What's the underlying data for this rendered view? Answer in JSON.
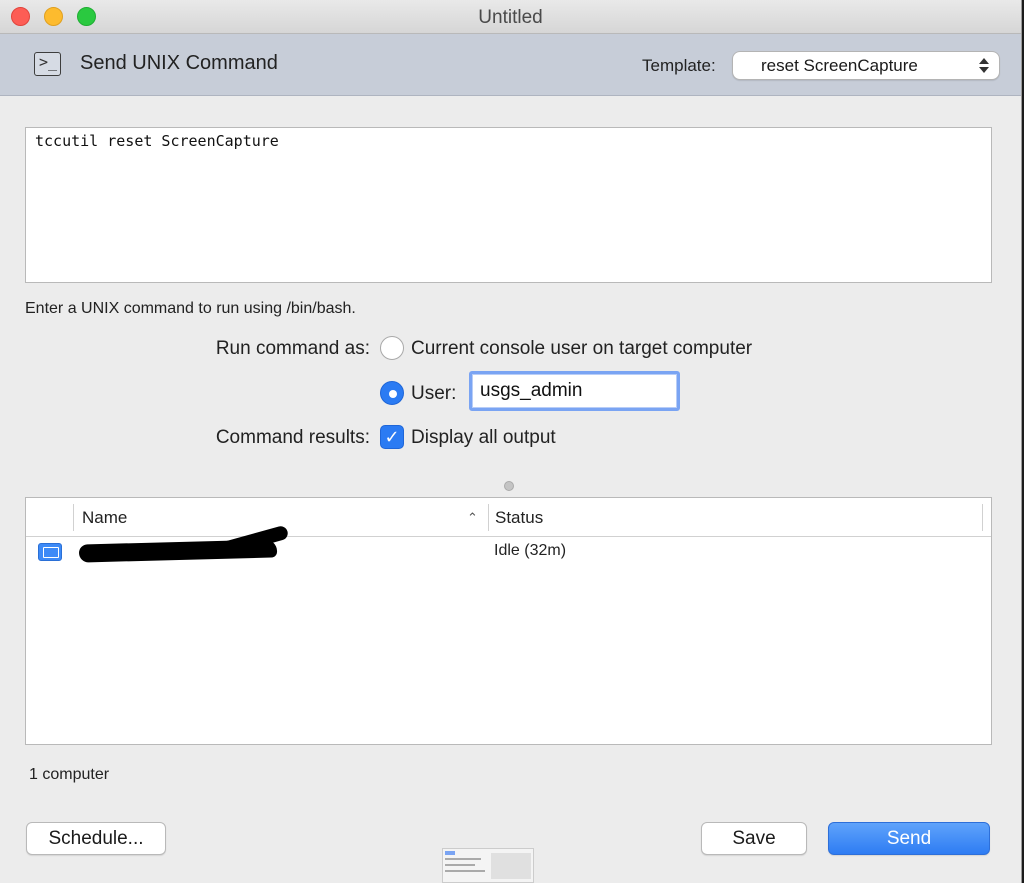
{
  "window": {
    "title": "Untitled"
  },
  "header": {
    "icon": "terminal-icon",
    "title": "Send UNIX Command",
    "template_label": "Template:",
    "template_value": "reset ScreenCapture"
  },
  "command": {
    "text": "tccutil reset ScreenCapture",
    "hint": "Enter a UNIX command to run using /bin/bash."
  },
  "run_as": {
    "label": "Run command as:",
    "option_console": "Current console user on target computer",
    "option_user": "User:",
    "user_value": "usgs_admin",
    "selected": "user"
  },
  "results": {
    "label": "Command results:",
    "display_all": "Display all output",
    "checked": true
  },
  "table": {
    "columns": [
      "Name",
      "Status"
    ],
    "rows": [
      {
        "icon": "computer-icon",
        "name": "",
        "status": "Idle (32m)"
      }
    ]
  },
  "footer": {
    "count": "1 computer",
    "schedule": "Schedule...",
    "save": "Save",
    "send": "Send"
  },
  "colors": {
    "accent": "#2b7bf3",
    "header_band": "#c7cdd8"
  }
}
